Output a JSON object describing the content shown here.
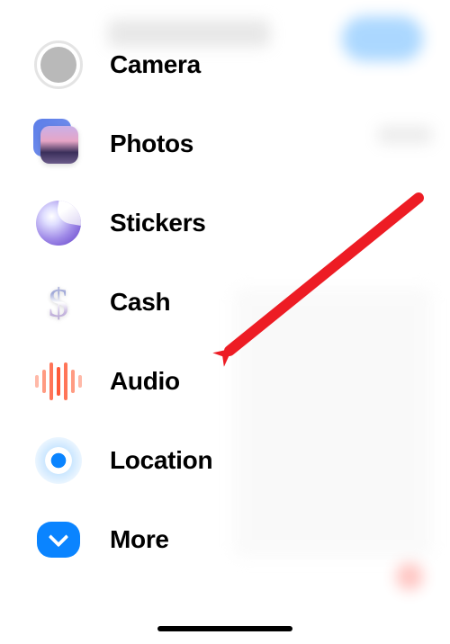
{
  "menu": {
    "items": [
      {
        "label": "Camera",
        "icon": "camera-icon"
      },
      {
        "label": "Photos",
        "icon": "photos-icon"
      },
      {
        "label": "Stickers",
        "icon": "stickers-icon"
      },
      {
        "label": "Cash",
        "icon": "cash-icon"
      },
      {
        "label": "Audio",
        "icon": "audio-icon"
      },
      {
        "label": "Location",
        "icon": "location-icon"
      },
      {
        "label": "More",
        "icon": "more-icon"
      }
    ]
  },
  "annotation": {
    "target": "Audio",
    "color": "#ed1c24"
  }
}
